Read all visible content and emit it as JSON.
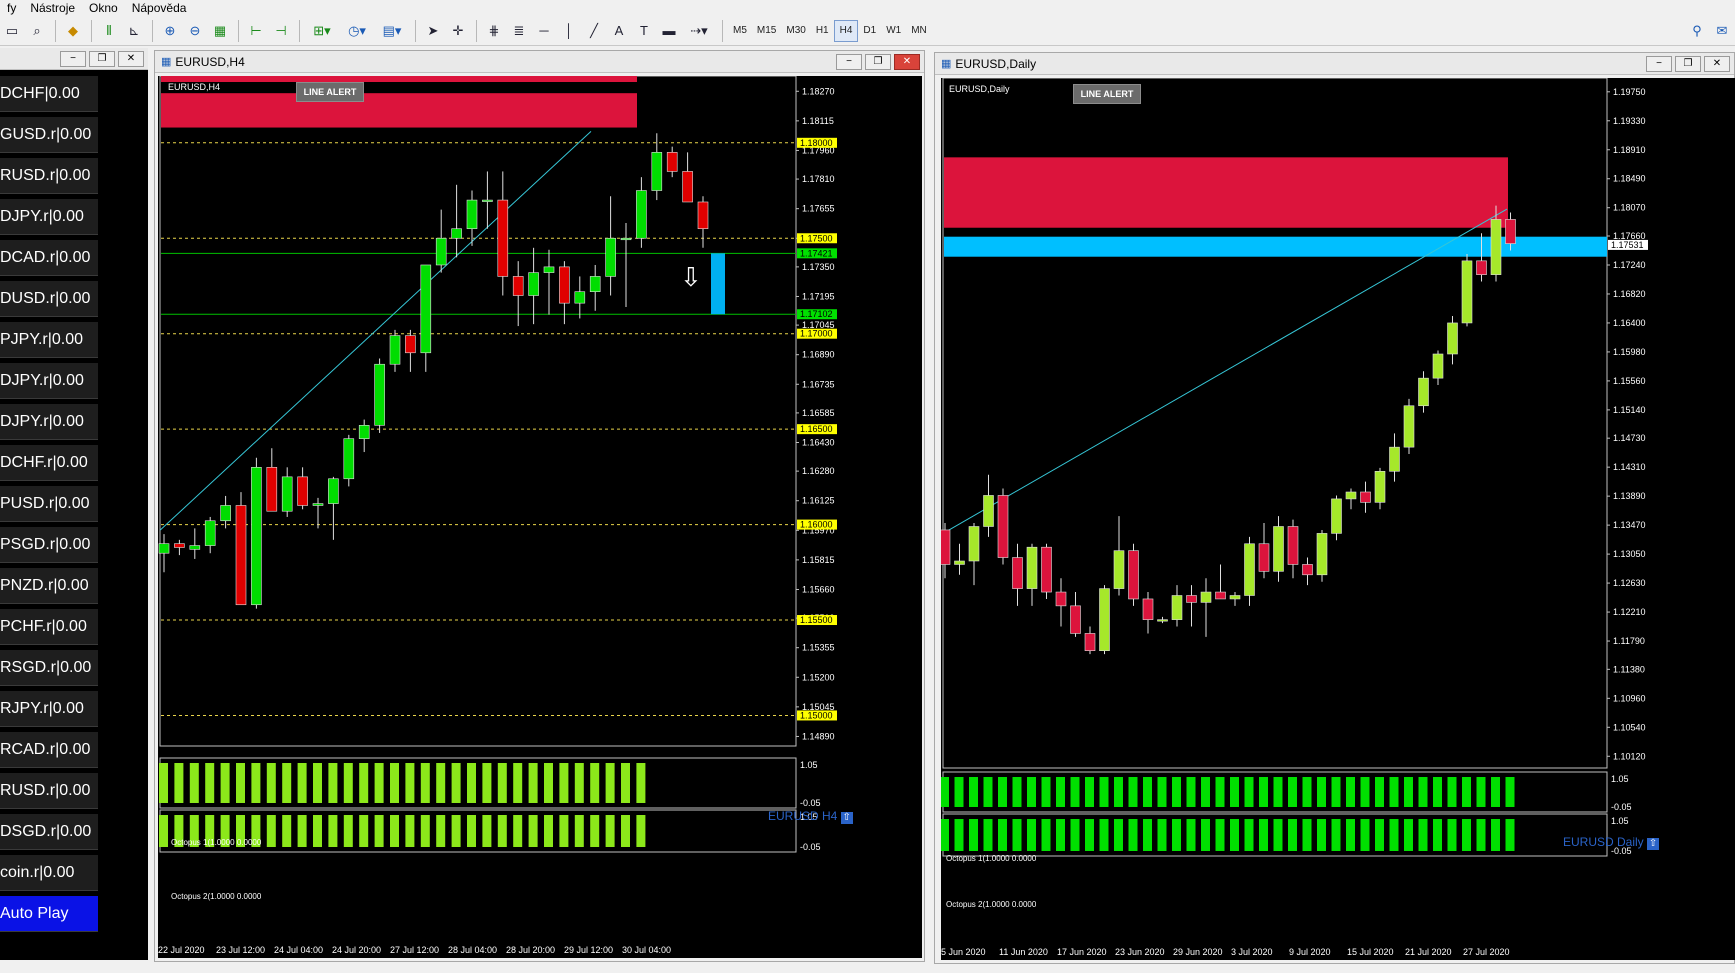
{
  "menu": {
    "items": [
      "fy",
      "Nástroje",
      "Okno",
      "Nápověda"
    ]
  },
  "toolbar": {
    "timeframes": [
      "M5",
      "M15",
      "M30",
      "H1",
      "H4",
      "D1",
      "W1",
      "MN"
    ],
    "active": "H4"
  },
  "watchlist": {
    "items": [
      "DCHF|0.00",
      "GUSD.r|0.00",
      "RUSD.r|0.00",
      "DJPY.r|0.00",
      "DCAD.r|0.00",
      "DUSD.r|0.00",
      "PJPY.r|0.00",
      "DJPY.r|0.00",
      "DJPY.r|0.00",
      "DCHF.r|0.00",
      "PUSD.r|0.00",
      "PSGD.r|0.00",
      "PNZD.r|0.00",
      "PCHF.r|0.00",
      "RSGD.r|0.00",
      "RJPY.r|0.00",
      "RCAD.r|0.00",
      "RUSD.r|0.00",
      "DSGD.r|0.00",
      "coin.r|0.00"
    ],
    "autoplay_label": "Auto Play"
  },
  "chart_h4": {
    "window_title": "EURUSD,H4",
    "inner_label": "EURUSD,H4",
    "alert_button": "LINE ALERT",
    "watermark": "EURUSD H4",
    "osc1_label": "Octopus 1(1.0000 0.0000",
    "osc2_label": "Octopus 2(1.0000 0.0000",
    "osc_axis": [
      "1.05",
      "-0.05",
      "1.05",
      "-0.05"
    ],
    "chart_data": {
      "type": "candlestick",
      "price_axis": [
        "1.18270",
        "1.18115",
        "1.17960",
        "1.17810",
        "1.17655",
        "1.17500",
        "1.17350",
        "1.17195",
        "1.17045",
        "1.16890",
        "1.16735",
        "1.16585",
        "1.16430",
        "1.16280",
        "1.16125",
        "1.15970",
        "1.15815",
        "1.15660",
        "1.15510",
        "1.15355",
        "1.15200",
        "1.15045",
        "1.14890"
      ],
      "ylim": [
        1.1484,
        1.1835
      ],
      "time_axis": [
        "22 Jul 2020",
        "23 Jul 12:00",
        "24 Jul 04:00",
        "24 Jul 20:00",
        "27 Jul 12:00",
        "28 Jul 04:00",
        "28 Jul 20:00",
        "29 Jul 12:00",
        "30 Jul 04:00"
      ],
      "level_tags": [
        {
          "price": 1.18,
          "text": "1.18000",
          "color": "#ffff00"
        },
        {
          "price": 1.175,
          "text": "1.17500",
          "color": "#ffff00"
        },
        {
          "price": 1.17421,
          "text": "1.17421",
          "color": "#00e000"
        },
        {
          "price": 1.17102,
          "text": "1.17102",
          "color": "#00e000"
        },
        {
          "price": 1.17,
          "text": "1.17000",
          "color": "#ffff00"
        },
        {
          "price": 1.165,
          "text": "1.16500",
          "color": "#ffff00"
        },
        {
          "price": 1.16,
          "text": "1.16000",
          "color": "#ffff00"
        },
        {
          "price": 1.155,
          "text": "1.15500",
          "color": "#ffff00"
        },
        {
          "price": 1.15,
          "text": "1.15000",
          "color": "#ffff00"
        }
      ],
      "resistance_zone": [
        1.1808,
        1.1826
      ],
      "support_lines": [
        1.17421,
        1.17102
      ],
      "colors": {
        "bull": "#00dd00",
        "bear": "#e00000",
        "zone": "#dc143c",
        "trend": "#36c6d6",
        "signal": "#00b0f0"
      },
      "candles": [
        [
          1.1585,
          1.1595,
          1.1575,
          1.159
        ],
        [
          1.159,
          1.1592,
          1.1584,
          1.1588
        ],
        [
          1.1587,
          1.1598,
          1.1582,
          1.1589
        ],
        [
          1.1589,
          1.1604,
          1.1585,
          1.1602
        ],
        [
          1.1602,
          1.1615,
          1.1598,
          1.161
        ],
        [
          1.161,
          1.1617,
          1.1558,
          1.1558
        ],
        [
          1.1558,
          1.1635,
          1.1556,
          1.163
        ],
        [
          1.163,
          1.164,
          1.1608,
          1.1607
        ],
        [
          1.1607,
          1.163,
          1.1604,
          1.1625
        ],
        [
          1.1625,
          1.163,
          1.1608,
          1.161
        ],
        [
          1.161,
          1.1614,
          1.1598,
          1.1611
        ],
        [
          1.1611,
          1.1625,
          1.1592,
          1.1624
        ],
        [
          1.1624,
          1.1647,
          1.162,
          1.1645
        ],
        [
          1.1645,
          1.1655,
          1.1638,
          1.1652
        ],
        [
          1.1652,
          1.1687,
          1.1648,
          1.1684
        ],
        [
          1.1684,
          1.1702,
          1.168,
          1.1699
        ],
        [
          1.1699,
          1.1702,
          1.168,
          1.169
        ],
        [
          1.169,
          1.1736,
          1.168,
          1.1736
        ],
        [
          1.1736,
          1.1765,
          1.1732,
          1.175
        ],
        [
          1.175,
          1.1778,
          1.174,
          1.1755
        ],
        [
          1.1755,
          1.1775,
          1.1746,
          1.177
        ],
        [
          1.177,
          1.1785,
          1.1755,
          1.177
        ],
        [
          1.177,
          1.1785,
          1.172,
          1.173
        ],
        [
          1.173,
          1.1738,
          1.1704,
          1.172
        ],
        [
          1.172,
          1.1745,
          1.1705,
          1.1732
        ],
        [
          1.1732,
          1.1744,
          1.171,
          1.1735
        ],
        [
          1.1735,
          1.1738,
          1.1705,
          1.1716
        ],
        [
          1.1716,
          1.173,
          1.1708,
          1.1722
        ],
        [
          1.1722,
          1.1736,
          1.1712,
          1.173
        ],
        [
          1.173,
          1.1772,
          1.172,
          1.175
        ],
        [
          1.175,
          1.1758,
          1.1714,
          1.175
        ],
        [
          1.175,
          1.1782,
          1.1745,
          1.1775
        ],
        [
          1.1775,
          1.1805,
          1.177,
          1.1795
        ],
        [
          1.1795,
          1.1798,
          1.1782,
          1.1785
        ],
        [
          1.1785,
          1.1795,
          1.177,
          1.1769
        ],
        [
          1.1769,
          1.1772,
          1.1745,
          1.1755
        ]
      ]
    }
  },
  "chart_daily": {
    "window_title": "EURUSD,Daily",
    "inner_label": "EURUSD,Daily",
    "alert_button": "LINE ALERT",
    "watermark": "EURUSD Daily",
    "osc1_label": "Octopus 1(1.0000 0.0000",
    "osc2_label": "Octopus 2(1.0000 0.0000",
    "osc_axis": [
      "1.05",
      "-0.05",
      "1.05",
      "-0.05"
    ],
    "chart_data": {
      "type": "candlestick",
      "price_axis": [
        "1.19750",
        "1.19330",
        "1.18910",
        "1.18490",
        "1.18070",
        "1.17660",
        "1.17240",
        "1.16820",
        "1.16400",
        "1.15980",
        "1.15560",
        "1.15140",
        "1.14730",
        "1.14310",
        "1.13890",
        "1.13470",
        "1.13050",
        "1.12630",
        "1.12210",
        "1.11790",
        "1.11380",
        "1.10960",
        "1.10540",
        "1.10120"
      ],
      "ylim": [
        1.0995,
        1.1995
      ],
      "time_axis": [
        "5 Jun 2020",
        "11 Jun 2020",
        "17 Jun 2020",
        "23 Jun 2020",
        "29 Jun 2020",
        "3 Jul 2020",
        "9 Jul 2020",
        "15 Jul 2020",
        "21 Jul 2020",
        "27 Jul 2020"
      ],
      "level_tags": [
        {
          "price": 1.17531,
          "text": "1.17531",
          "color": "#ffffff"
        }
      ],
      "resistance_zone": [
        1.1778,
        1.188
      ],
      "support_zone": [
        1.1736,
        1.1765
      ],
      "colors": {
        "bull": "#a6e82a",
        "bear": "#dc143c",
        "zone": "#dc143c",
        "support": "#00bfff",
        "trend": "#36c6d6"
      },
      "candles": [
        [
          1.134,
          1.135,
          1.127,
          1.129
        ],
        [
          1.129,
          1.132,
          1.1275,
          1.1295
        ],
        [
          1.1295,
          1.135,
          1.126,
          1.1345
        ],
        [
          1.1345,
          1.142,
          1.133,
          1.139
        ],
        [
          1.139,
          1.14,
          1.129,
          1.13
        ],
        [
          1.13,
          1.132,
          1.123,
          1.1255
        ],
        [
          1.1255,
          1.132,
          1.123,
          1.1315
        ],
        [
          1.1315,
          1.132,
          1.124,
          1.125
        ],
        [
          1.125,
          1.127,
          1.12,
          1.123
        ],
        [
          1.123,
          1.125,
          1.1185,
          1.119
        ],
        [
          1.119,
          1.12,
          1.116,
          1.1165
        ],
        [
          1.1165,
          1.126,
          1.116,
          1.1255
        ],
        [
          1.1255,
          1.136,
          1.1245,
          1.131
        ],
        [
          1.131,
          1.132,
          1.123,
          1.124
        ],
        [
          1.124,
          1.125,
          1.119,
          1.121
        ],
        [
          1.121,
          1.1214,
          1.1205,
          1.121
        ],
        [
          1.121,
          1.126,
          1.12,
          1.1245
        ],
        [
          1.1245,
          1.126,
          1.12,
          1.1235
        ],
        [
          1.1235,
          1.127,
          1.1185,
          1.125
        ],
        [
          1.125,
          1.129,
          1.124,
          1.124
        ],
        [
          1.124,
          1.125,
          1.123,
          1.1245
        ],
        [
          1.1245,
          1.133,
          1.123,
          1.132
        ],
        [
          1.132,
          1.135,
          1.127,
          1.128
        ],
        [
          1.128,
          1.136,
          1.1265,
          1.1345
        ],
        [
          1.1345,
          1.1355,
          1.127,
          1.129
        ],
        [
          1.129,
          1.13,
          1.126,
          1.1275
        ],
        [
          1.1275,
          1.134,
          1.1265,
          1.1335
        ],
        [
          1.1335,
          1.139,
          1.1325,
          1.1385
        ],
        [
          1.1385,
          1.14,
          1.137,
          1.1395
        ],
        [
          1.1395,
          1.141,
          1.1365,
          1.138
        ],
        [
          1.138,
          1.143,
          1.137,
          1.1425
        ],
        [
          1.1425,
          1.148,
          1.141,
          1.146
        ],
        [
          1.146,
          1.153,
          1.145,
          1.152
        ],
        [
          1.152,
          1.157,
          1.151,
          1.156
        ],
        [
          1.156,
          1.16,
          1.155,
          1.1595
        ],
        [
          1.1595,
          1.165,
          1.158,
          1.164
        ],
        [
          1.164,
          1.174,
          1.1635,
          1.173
        ],
        [
          1.173,
          1.177,
          1.17,
          1.171
        ],
        [
          1.171,
          1.181,
          1.17,
          1.179
        ],
        [
          1.179,
          1.18,
          1.1745,
          1.1755
        ]
      ]
    }
  }
}
